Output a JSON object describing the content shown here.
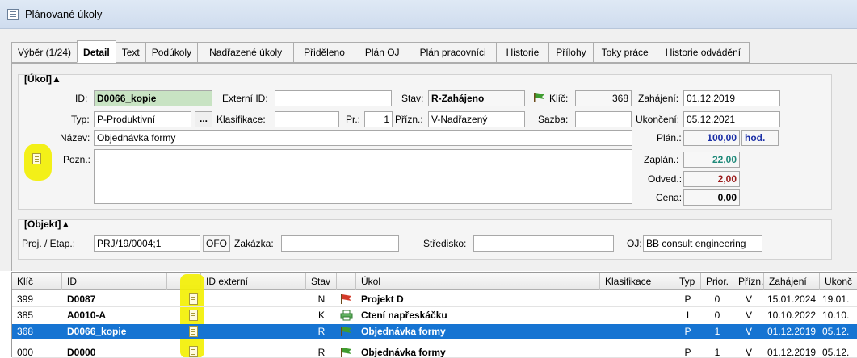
{
  "window": {
    "title": "Plánované úkoly"
  },
  "tabs": [
    {
      "label": "Výběr (1/24)"
    },
    {
      "label": "Detail"
    },
    {
      "label": "Text"
    },
    {
      "label": "Podúkoly"
    },
    {
      "label": "Nadřazené úkoly"
    },
    {
      "label": "Přiděleno"
    },
    {
      "label": "Plán OJ"
    },
    {
      "label": "Plán pracovníci"
    },
    {
      "label": "Historie"
    },
    {
      "label": "Přílohy"
    },
    {
      "label": "Toky práce"
    },
    {
      "label": "Historie odvádění"
    }
  ],
  "ukol": {
    "section_title": "[Úkol]▲",
    "id_label": "ID:",
    "id_value": "D0066_kopie",
    "ext_id_label": "Externí ID:",
    "ext_id_value": "",
    "stav_label": "Stav:",
    "stav_value": "R-Zahájeno",
    "klic_label": "Klíč:",
    "klic_value": "368",
    "zahajeni_label": "Zahájení:",
    "zahajeni_value": "01.12.2019",
    "typ_label": "Typ:",
    "typ_value": "P-Produktivní",
    "dots_label": "...",
    "klasifikace_label": "Klasifikace:",
    "klasifikace_value": "",
    "pr_label": "Pr.:",
    "pr_value": "1",
    "prizn_label": "Přízn.:",
    "prizn_value": "V-Nadřazený",
    "sazba_label": "Sazba:",
    "sazba_value": "",
    "ukonceni_label": "Ukončení:",
    "ukonceni_value": "05.12.2021",
    "nazev_label": "Název:",
    "nazev_value": "Objednávka formy",
    "plan_label": "Plán.:",
    "plan_value": "100,00",
    "plan_unit": "hod.",
    "pozn_label": "Pozn.:",
    "pozn_value": "",
    "zaplan_label": "Zaplán.:",
    "zaplan_value": "22,00",
    "odved_label": "Odved.:",
    "odved_value": "2,00",
    "cena_label": "Cena:",
    "cena_value": "0,00"
  },
  "objekt": {
    "section_title": "[Objekt]▲",
    "proj_label": "Proj. / Etap.:",
    "proj_value": "PRJ/19/0004;1",
    "ofo_value": "OFO",
    "zakazka_label": "Zakázka:",
    "zakazka_value": "",
    "stredisko_label": "Středisko:",
    "stredisko_value": "",
    "oj_label": "OJ:",
    "oj_value": "BB consult engineering"
  },
  "grid": {
    "headers": [
      "Klíč",
      "ID",
      "",
      "ID externí",
      "Stav",
      "",
      "Úkol",
      "Klasifikace",
      "Typ",
      "Prior.",
      "Přízn.",
      "Zahájení",
      "Ukonč"
    ],
    "rows": [
      {
        "klic": "399",
        "id": "D0087",
        "stav": "N",
        "ukol": "Projekt D",
        "typ": "P",
        "prior": "0",
        "prizn": "V",
        "zahajeni": "15.01.2024",
        "ukonceni": "19.01.",
        "flag": "red",
        "selected": false
      },
      {
        "klic": "385",
        "id": "A0010-A",
        "stav": "K",
        "ukol": "Ctení napřeskáčku",
        "typ": "I",
        "prior": "0",
        "prizn": "V",
        "zahajeni": "10.10.2022",
        "ukonceni": "10.10.",
        "flag": "green-print",
        "selected": false
      },
      {
        "klic": "368",
        "id": "D0066_kopie",
        "stav": "R",
        "ukol": "Objednávka formy",
        "typ": "P",
        "prior": "1",
        "prizn": "V",
        "zahajeni": "01.12.2019",
        "ukonceni": "05.12.",
        "flag": "green",
        "selected": true
      },
      {
        "klic": "000",
        "id": "D0000",
        "stav": "R",
        "ukol": "Objednávka formy",
        "typ": "P",
        "prior": "1",
        "prizn": "V",
        "zahajeni": "01.12.2019",
        "ukonceni": "05.12.",
        "flag": "green",
        "selected": false
      }
    ]
  },
  "colors": {
    "selection": "#1674d2",
    "highlight": "#f3f000",
    "id_field": "#c8e3c3"
  }
}
